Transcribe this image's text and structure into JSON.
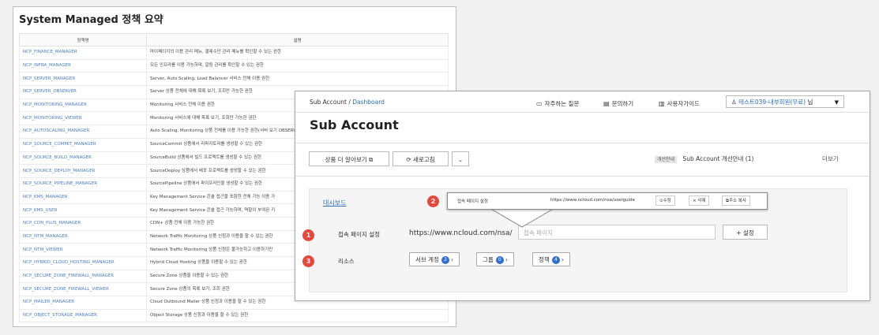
{
  "left_panel": {
    "title": "System Managed 정책 요약",
    "columns": [
      "정책명",
      "설명"
    ],
    "rows": [
      {
        "name": "NCP_FINANCE_MANAGER",
        "desc": "마이페이지의 이용 관리 메뉴, 결제수단 관리 메뉴를 확인할 수 있는 권한"
      },
      {
        "name": "NCP_INFRA_MANAGER",
        "desc": "모든 인프라를 이용 가능하며, 알림 관리를 확인할 수 있는 권한"
      },
      {
        "name": "NCP_SERVER_MANAGER",
        "desc": "Server, Auto Scaling, Load Balancer 서비스 전체 이용 권한"
      },
      {
        "name": "NCP_SERVER_OBSERVER",
        "desc": "Server 상품 전체에 대해 목록 보기, 조회만 가능한 권한"
      },
      {
        "name": "NCP_MONITORING_MANAGER",
        "desc": "Monitoring 서비스 전체 이용 권한"
      },
      {
        "name": "NCP_MONITORING_VIEWER",
        "desc": "Monitoring 서비스에 대해 목록 보기, 조회만 가능한 권한"
      },
      {
        "name": "NCP_AUTOSCALING_MANAGER",
        "desc": "Auto Scaling, Monitoring 상품 전체를 이용 가능한 권한(서버 보기 OBSERVER 권한을 추가로 부여하세요.)"
      },
      {
        "name": "NCP_SOURCE_COMMIT_MANAGER",
        "desc": "SourceCommit 상품에서 리파지토리를 생성할 수 있는 권한"
      },
      {
        "name": "NCP_SOURCE_BUILD_MANAGER",
        "desc": "SourceBuild 상품에서 빌드 프로젝트를 생성할 수 있는 권한"
      },
      {
        "name": "NCP_SOURCE_DEPLOY_MANAGER",
        "desc": "SourceDeploy 상품에서 배포 프로젝트를 생성할 수 있는 권한"
      },
      {
        "name": "NCP_SOURCE_PIPELINE_MANAGER",
        "desc": "SourcePipeline 상품에서 파이프라인을 생성할 수 있는 권한"
      },
      {
        "name": "NCP_KMS_MANAGER",
        "desc": "Key Management Service 콘솔 접근을 포함한 전체 기능 이용 가"
      },
      {
        "name": "NCP_KMS_USER",
        "desc": "Key Management Service 콘솔 접근 가능하며, 역할이 부여된 키"
      },
      {
        "name": "NCP_CDN_PLUS_MANAGER",
        "desc": "CDN+ 상품 전체 이용 가능한 권한"
      },
      {
        "name": "NCP_NTM_MANAGER",
        "desc": "Network Traffic Monitoring 상품 신청과 이용을 할 수 있는 권한"
      },
      {
        "name": "NCP_NTM_VIEWER",
        "desc": "Network Traffic Monitoring 상품 신청은 불가능하고 이용하기만"
      },
      {
        "name": "NCP_HYBRID_CLOUD_HOSTING_MANAGER",
        "desc": "Hybrid Cloud Hosting 상품을 이용할 수 있는 권한"
      },
      {
        "name": "NCP_SECURE_ZONE_FIREWALL_MANAGER",
        "desc": "Secure Zone 상품을 이용할 수 있는 권한"
      },
      {
        "name": "NCP_SECURE_ZONE_FIREWALL_VIEWER",
        "desc": "Secure Zone 상품의 목록 보기, 조회 권한"
      },
      {
        "name": "NCP_MAILER_MANAGER",
        "desc": "Cloud Outbound Mailer 상품 신청과 이용을 할 수 있는 권한"
      },
      {
        "name": "NCP_OBJECT_STORAGE_MANAGER",
        "desc": "Object Storage 상품 신청과 이용을 할 수 있는 권한"
      }
    ]
  },
  "right_panel": {
    "breadcrumb_root": "Sub Account /",
    "breadcrumb_current": "Dashboard",
    "nav": {
      "faq": "자주하는 질문",
      "inquiry": "문의하기",
      "guide": "사용자가이드"
    },
    "user": {
      "name": "테스트039-내부회원(무료)",
      "suffix": "님"
    },
    "title": "Sub Account",
    "buttons": {
      "learn_more": "상품 더 알아보기",
      "refresh": "새로고침"
    },
    "notice": {
      "tag": "개선안내",
      "text": "Sub Account 개선안내 (1)",
      "more": "더보기"
    },
    "dashboard_link": "대시보드",
    "login_page": {
      "label": "접속 페이지 설정",
      "url_prefix": "https://www.ncloud.com/nsa/",
      "placeholder": "접속 페이지",
      "set_button": "+ 설정"
    },
    "resources": {
      "label": "리소스",
      "items": [
        {
          "label": "서브 계정",
          "count": "2"
        },
        {
          "label": "그룹",
          "count": "0"
        },
        {
          "label": "정책",
          "count": "4"
        }
      ]
    }
  },
  "callout": {
    "label": "접속 페이지 설정",
    "url": "https://www.ncloud.com/nsa/userguide",
    "edit": "수정",
    "delete": "삭제",
    "copy": "주소 복사"
  },
  "badges": [
    "1",
    "2",
    "3"
  ],
  "colors": {
    "accent": "#2a6ec0",
    "badge": "#e8473b",
    "count": "#2f6fd0"
  }
}
